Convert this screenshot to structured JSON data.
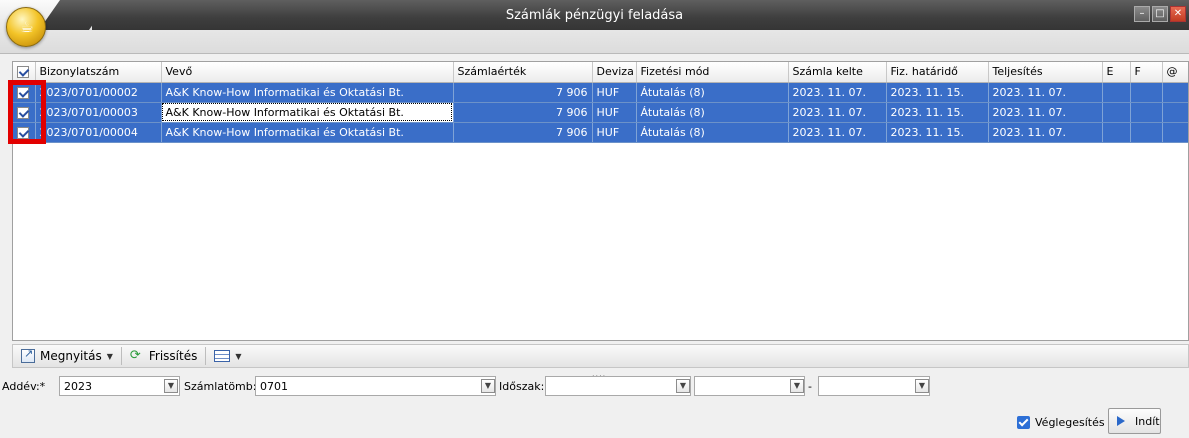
{
  "window": {
    "title": "Számlák pénzügyi feladása",
    "controls": [
      "minimize",
      "maximize",
      "close"
    ]
  },
  "grid": {
    "columns": [
      "Bizonylatszám",
      "Vevő",
      "Számlaérték",
      "Deviza",
      "Fizetési mód",
      "Számla kelte",
      "Fiz. határidő",
      "Teljesítés",
      "E",
      "F",
      "@"
    ],
    "rows": [
      {
        "checked": true,
        "bizonylatszam": "2023/0701/00002",
        "vevo": "A&K Know-How Informatikai és Oktatási Bt.",
        "ertek": "7 906",
        "deviza": "HUF",
        "fizmod": "Átutalás (8)",
        "kelte": "2023. 11. 07.",
        "hatarido": "2023. 11. 15.",
        "teljesites": "2023. 11. 07.",
        "e": "",
        "f": "",
        "at": ""
      },
      {
        "checked": true,
        "bizonylatszam": "2023/0701/00003",
        "vevo": "A&K Know-How Informatikai és Oktatási Bt.",
        "ertek": "7 906",
        "deviza": "HUF",
        "fizmod": "Átutalás (8)",
        "kelte": "2023. 11. 07.",
        "hatarido": "2023. 11. 15.",
        "teljesites": "2023. 11. 07.",
        "e": "",
        "f": "",
        "at": ""
      },
      {
        "checked": true,
        "bizonylatszam": "2023/0701/00004",
        "vevo": "A&K Know-How Informatikai és Oktatási Bt.",
        "ertek": "7 906",
        "deviza": "HUF",
        "fizmod": "Átutalás (8)",
        "kelte": "2023. 11. 07.",
        "hatarido": "2023. 11. 15.",
        "teljesites": "2023. 11. 07.",
        "e": "",
        "f": "",
        "at": ""
      }
    ]
  },
  "toolbar": {
    "open_label": "Megnyitás",
    "refresh_label": "Frissítés",
    "grid_menu_icon": "grid-settings-icon"
  },
  "filters": {
    "year_label": "Addév:*",
    "year_value": "2023",
    "block_label": "Számlatömb:*",
    "block_value": "0701",
    "period_label": "Időszak:",
    "period_value": "",
    "from_value": "",
    "dash": "-",
    "to_value": ""
  },
  "footer": {
    "finalize_label": "Véglegesítés",
    "finalize_checked": true,
    "start_label": "Indít"
  },
  "colors": {
    "selection": "#3a6ec8",
    "highlight_box": "#e20000"
  }
}
